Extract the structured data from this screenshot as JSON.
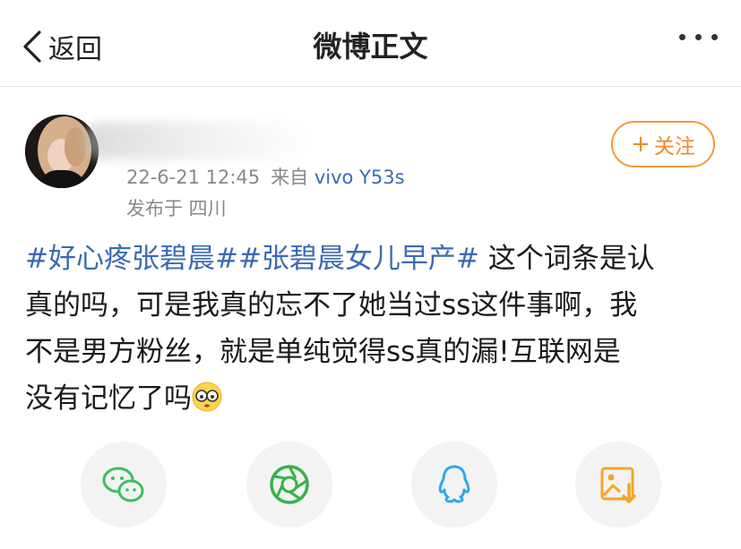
{
  "nav": {
    "back_label": "返回",
    "title": "微博正文",
    "more_icon": "more-icon"
  },
  "author": {
    "avatar_icon": "avatar",
    "post_date": "22-6-21 12:45",
    "source_prefix": "来自",
    "source_device": "vivo Y53s",
    "location": "发布于 四川"
  },
  "follow": {
    "label": "关注"
  },
  "post": {
    "line1": {
      "tag1": "#好心疼张碧晨#",
      "tag2": "#张碧晨女儿早产#",
      "text": " 这个词条是认"
    },
    "line2": "真的吗，可是我真的忘不了她当过ss这件事啊，我",
    "line3": "不是男方粉丝，就是单纯觉得ss真的漏!互联网是",
    "line4": "没有记忆了吗",
    "emoji": "glasses-face-emoji"
  },
  "share": [
    {
      "icon": "wechat-icon",
      "color": "#3cbf5e"
    },
    {
      "icon": "moments-icon",
      "color": "#35b24a"
    },
    {
      "icon": "qq-icon",
      "color": "#2fa7ec"
    },
    {
      "icon": "save-image-icon",
      "color": "#f5a623"
    }
  ]
}
